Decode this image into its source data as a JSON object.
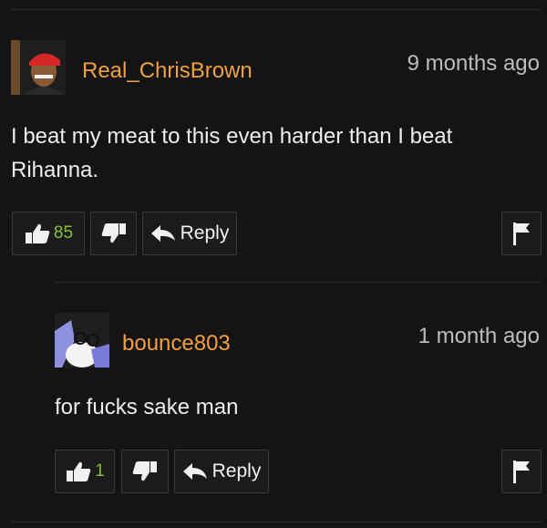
{
  "colors": {
    "background": "#141414",
    "username": "#f0a040",
    "like_count": "#84c23a",
    "button_border": "#3a3a3a"
  },
  "comments": [
    {
      "username": "Real_ChrisBrown",
      "time": "9 months ago",
      "text": "I beat my meat to this even harder than I beat Rihanna.",
      "likes": "85",
      "reply_label": "Reply",
      "icons": [
        "thumbs-up-icon",
        "thumbs-down-icon",
        "reply-arrow-icon",
        "flag-icon"
      ]
    },
    {
      "username": "bounce803",
      "time": "1 month ago",
      "text": "for fucks sake man",
      "likes": "1",
      "reply_label": "Reply",
      "icons": [
        "thumbs-up-icon",
        "thumbs-down-icon",
        "reply-arrow-icon",
        "flag-icon"
      ]
    }
  ]
}
